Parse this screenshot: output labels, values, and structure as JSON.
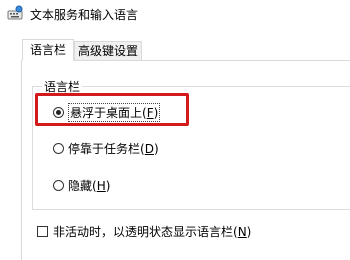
{
  "window": {
    "title": "文本服务和输入语言",
    "icon": "keyboard-language-icon"
  },
  "tabs": [
    {
      "label": "语言栏",
      "active": true
    },
    {
      "label": "高级键设置",
      "active": false
    }
  ],
  "language_bar_group": {
    "legend": "语言栏",
    "options": [
      {
        "text": "悬浮于桌面上(",
        "key": "F",
        "end": ")",
        "checked": true
      },
      {
        "text": "停靠于任务栏(",
        "key": "D",
        "end": ")",
        "checked": false
      },
      {
        "text": "隐藏(",
        "key": "H",
        "end": ")",
        "checked": false
      }
    ]
  },
  "inactive_option": {
    "text": "非活动时，以透明状态显示语言栏(",
    "key": "N",
    "end": ")",
    "checked": false
  },
  "colors": {
    "highlight_border": "#d2191b",
    "tab_inactive_bg": "#f0f0f0"
  }
}
